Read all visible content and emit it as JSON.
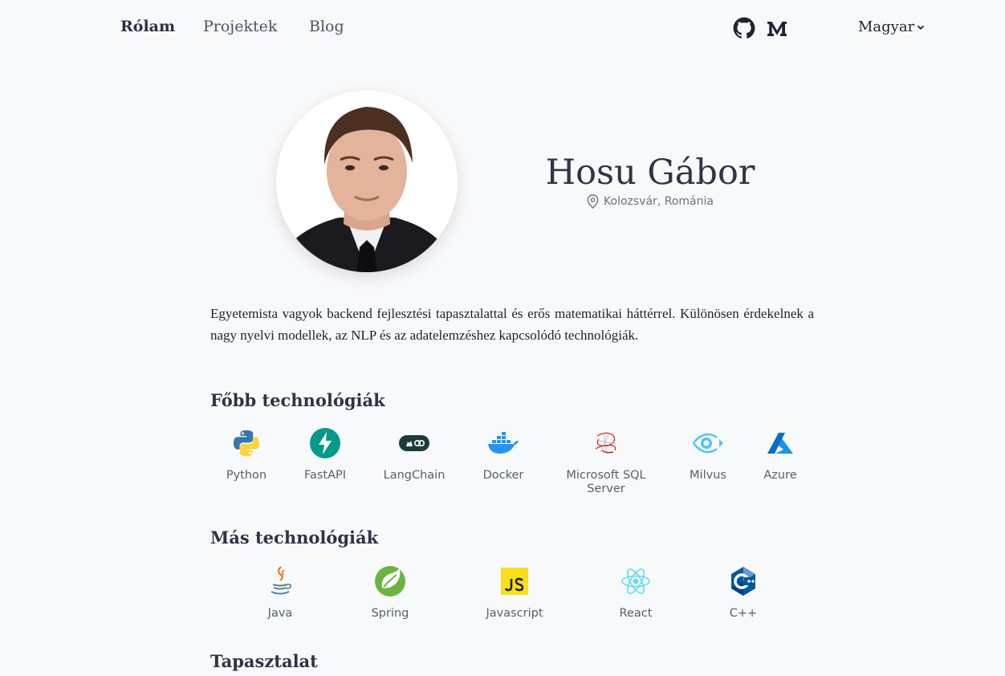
{
  "nav": {
    "links": [
      {
        "label": "Rólam"
      },
      {
        "label": "Projektek"
      },
      {
        "label": "Blog"
      }
    ],
    "language": "Magyar"
  },
  "profile": {
    "name": "Hosu Gábor",
    "location": "Kolozsvár, Románia",
    "intro": "Egyetemista vagyok backend fejlesztési tapasztalattal és erős matematikai háttérrel. Különösen érdekelnek a nagy nyelvi modellek, az NLP és az adatelemzéshez kapcsolódó technológiák."
  },
  "main_tech": {
    "title": "Főbb technológiák",
    "items": [
      {
        "label": "Python",
        "icon": "python-icon"
      },
      {
        "label": "FastAPI",
        "icon": "fastapi-icon"
      },
      {
        "label": "LangChain",
        "icon": "langchain-icon"
      },
      {
        "label": "Docker",
        "icon": "docker-icon"
      },
      {
        "label": "Microsoft SQL Server",
        "icon": "mssql-icon"
      },
      {
        "label": "Milvus",
        "icon": "milvus-icon"
      },
      {
        "label": "Azure",
        "icon": "azure-icon"
      }
    ]
  },
  "other_tech": {
    "title": "Más technológiák",
    "items": [
      {
        "label": "Java",
        "icon": "java-icon"
      },
      {
        "label": "Spring",
        "icon": "spring-icon"
      },
      {
        "label": "Javascript",
        "icon": "javascript-icon"
      },
      {
        "label": "React",
        "icon": "react-icon"
      },
      {
        "label": "C++",
        "icon": "cpp-icon"
      }
    ]
  },
  "experience": {
    "title": "Tapasztalat"
  },
  "colors": {
    "background": "#f8f9fb",
    "heading": "#2d3446",
    "fastapi": "#05998b",
    "python_blue": "#3776ab",
    "python_yellow": "#ffd43b",
    "docker": "#2496ed",
    "azure": "#0078d4",
    "javascript": "#f7df1e",
    "react": "#61dafb",
    "spring": "#6db33f",
    "cpp": "#00599c"
  }
}
